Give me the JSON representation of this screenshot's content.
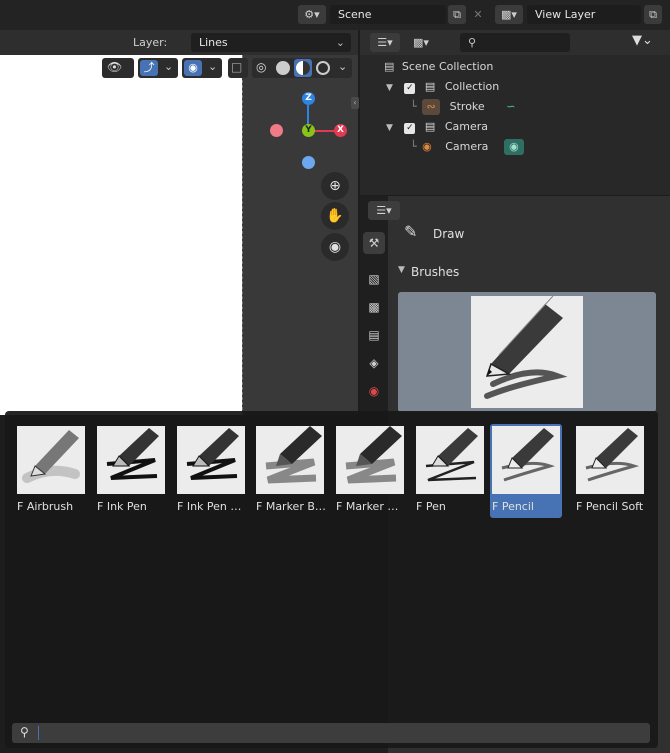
{
  "topbar": {
    "scene_label": "Scene",
    "view_layer_label": "View Layer"
  },
  "viewport": {
    "layer_label": "Layer:",
    "layer_value": "Lines",
    "gizmo": {
      "z": "Z",
      "y": "Y",
      "x": "X"
    }
  },
  "outliner": {
    "items": [
      {
        "label": "Scene Collection",
        "icon": "scene-collection-icon"
      },
      {
        "label": "Collection",
        "icon": "collection-icon"
      },
      {
        "label": "Stroke",
        "icon": "grease-pencil-icon"
      },
      {
        "label": "Camera",
        "icon": "collection-icon"
      },
      {
        "label": "Camera",
        "icon": "camera-object-icon"
      }
    ]
  },
  "properties": {
    "tool_name": "Draw",
    "brushes_header": "Brushes"
  },
  "popup": {
    "brushes": [
      {
        "label": "F Airbrush",
        "kind": "airbrush",
        "active": false
      },
      {
        "label": "F Ink Pen",
        "kind": "ink",
        "active": false
      },
      {
        "label": "F Ink Pen Ro…",
        "kind": "ink",
        "active": false
      },
      {
        "label": "F Marker Bold",
        "kind": "marker",
        "active": false
      },
      {
        "label": "F Marker Chi…",
        "kind": "marker",
        "active": false
      },
      {
        "label": "F Pen",
        "kind": "pen",
        "active": false
      },
      {
        "label": "F Pencil",
        "kind": "pencil",
        "active": true
      },
      {
        "label": "F Pencil Soft",
        "kind": "pencil",
        "active": false
      }
    ],
    "search_placeholder": ""
  },
  "colors": {
    "accent": "#4772b3",
    "gizmo_x": "#e23a53",
    "gizmo_y": "#88c51b",
    "gizmo_z": "#2f83e3"
  }
}
